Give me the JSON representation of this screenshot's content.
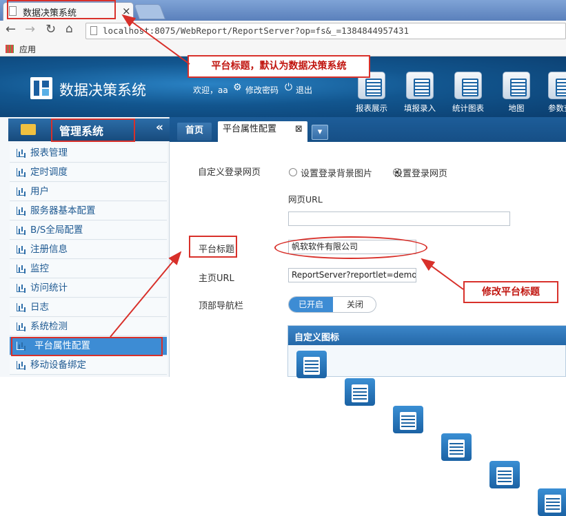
{
  "browser": {
    "tab_title": "数据决策系统",
    "tab_close": "×",
    "url": "localhost:8075/WebReport/ReportServer?op=fs&_=1384844957431",
    "bookmark_apps": "应用"
  },
  "header": {
    "logo_text": "数据决策系统",
    "welcome": "欢迎，aa",
    "change_password": "修改密码",
    "logout": "退出",
    "nav": [
      {
        "label": "报表展示"
      },
      {
        "label": "填报录入"
      },
      {
        "label": "统计图表"
      },
      {
        "label": "地图"
      },
      {
        "label": "参数查"
      }
    ]
  },
  "sidebar": {
    "title": "管理系统",
    "collapse": "«",
    "items": [
      {
        "label": "报表管理"
      },
      {
        "label": "定时调度"
      },
      {
        "label": "用户"
      },
      {
        "label": "服务器基本配置"
      },
      {
        "label": "B/S全局配置"
      },
      {
        "label": "注册信息"
      },
      {
        "label": "监控"
      },
      {
        "label": "访问统计"
      },
      {
        "label": "日志"
      },
      {
        "label": "系统检测"
      },
      {
        "label": "平台属性配置"
      },
      {
        "label": "移动设备绑定"
      }
    ],
    "active_index": 10
  },
  "content_tabs": {
    "home": "首页",
    "active": "平台属性配置",
    "close": "⊠",
    "dropdown": "▾"
  },
  "form": {
    "login_label": "自定义登录网页",
    "radio_bg": "设置登录背景图片",
    "radio_page": "设置登录网页",
    "selected_radio": "设置登录网页",
    "url_label": "网页URL",
    "url_value": "",
    "title_label": "平台标题",
    "title_value": "帆软软件有限公司",
    "home_url_label": "主页URL",
    "home_url_value": "ReportServer?reportlet=demo...",
    "topnav_label": "顶部导航栏",
    "toggle_on": "已开启",
    "toggle_off": "关闭",
    "toggle_state": "on",
    "custom_icon_title": "自定义图标"
  },
  "annotations": {
    "platform_title_default": "平台标题，默认为数据决策系统",
    "modify_title": "修改平台标题"
  },
  "colors": {
    "header_blue": "#12568f",
    "annotation_red": "#d8302a",
    "active_item": "#3d8cd4"
  }
}
